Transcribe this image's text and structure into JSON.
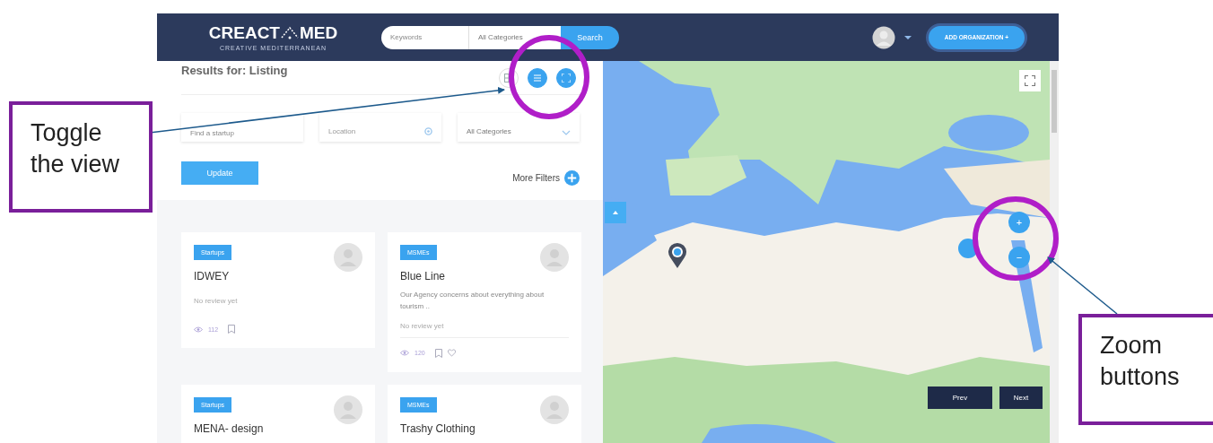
{
  "header": {
    "logo_left": "CREACT",
    "logo_right": "MED",
    "tagline": "CREATIVE MEDITERRANEAN",
    "keyword_placeholder": "Keywords",
    "category": "All Categories",
    "search_button": "Search",
    "add_button": "ADD ORGANIZATION +"
  },
  "results": {
    "title": "Results for: Listing",
    "views": [
      {
        "kind": "grid",
        "selected": false
      },
      {
        "kind": "list",
        "selected": true
      }
    ]
  },
  "filters": {
    "name_placeholder": "Find a startup",
    "location_placeholder": "Location",
    "category": "All Categories",
    "update": "Update",
    "more": "More Filters"
  },
  "listings": [
    {
      "tag": "Startups",
      "title": "IDWEY",
      "review": "No review yet",
      "views": "112",
      "has_like": false
    },
    {
      "tag": "MSMEs",
      "title": "Blue Line",
      "description": "Our Agency concerns about everything about tourism ..",
      "review": "No review yet",
      "views": "120",
      "has_like": true
    },
    {
      "tag": "Startups",
      "title": "MENA- design"
    },
    {
      "tag": "MSMEs",
      "title": "Trashy Clothing"
    }
  ],
  "map": {
    "kind": "picture",
    "zoom_in": "+",
    "zoom_out": "−",
    "prev": "Prev",
    "next": "Next"
  },
  "annotations": [
    {
      "text": "Toggle the view"
    },
    {
      "text": "Zoom buttons"
    }
  ]
}
